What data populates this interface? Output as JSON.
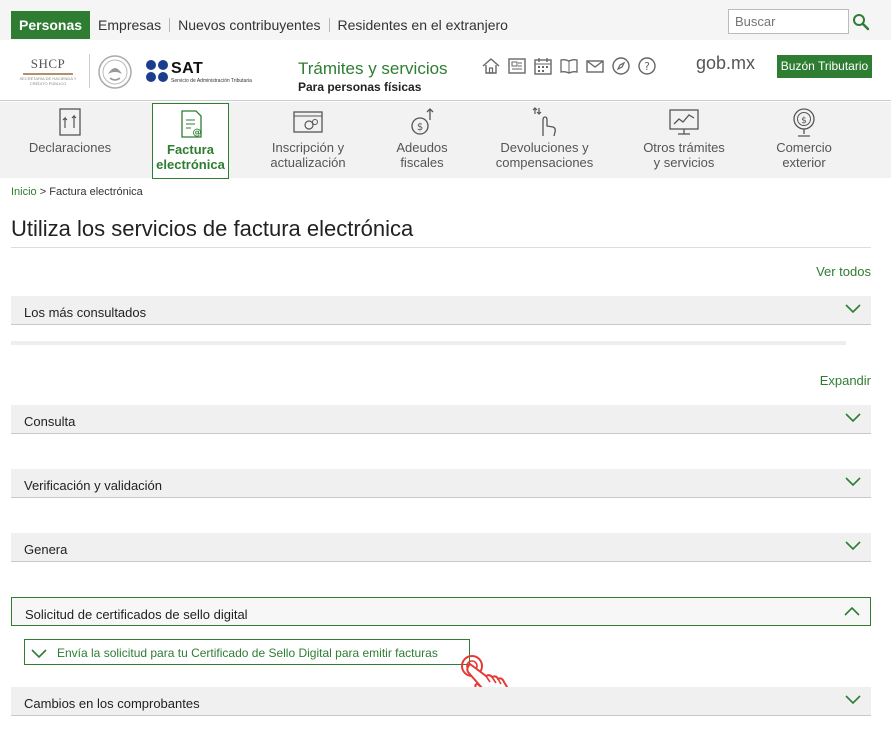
{
  "topbar": {
    "tabs": [
      {
        "label": "Personas",
        "active": true
      },
      {
        "label": "Empresas"
      },
      {
        "label": "Nuevos contribuyentes"
      },
      {
        "label": "Residentes en el extranjero"
      }
    ],
    "search_placeholder": "Buscar",
    "search_icon": "search-icon"
  },
  "header": {
    "shcp_logo": "SHCP",
    "shcp_sub": "SECRETARÍA DE HACIENDA Y CRÉDITO PÚBLICO",
    "sat_logo": "SAT",
    "sat_sub": "Servicio de Administración Tributaria",
    "title": "Trámites y servicios",
    "subtitle": "Para personas físicas",
    "icons": [
      "home-icon",
      "news-icon",
      "calendar-icon",
      "book-icon",
      "mail-icon",
      "compass-icon",
      "help-icon"
    ],
    "gobmx": "gob.mx",
    "buzon": "Buzón Tributario"
  },
  "categories": [
    {
      "line1": "Declaraciones",
      "line2": "",
      "icon": "declarations-icon"
    },
    {
      "line1": "Factura",
      "line2": "electrónica",
      "icon": "invoice-icon",
      "active": true
    },
    {
      "line1": "Inscripción y",
      "line2": "actualización",
      "icon": "registration-icon"
    },
    {
      "line1": "Adeudos",
      "line2": "fiscales",
      "icon": "debts-icon"
    },
    {
      "line1": "Devoluciones y",
      "line2": "compensaciones",
      "icon": "refunds-icon"
    },
    {
      "line1": "Otros trámites",
      "line2": "y servicios",
      "icon": "other-services-icon"
    },
    {
      "line1": "Comercio",
      "line2": "exterior",
      "icon": "foreign-trade-icon"
    }
  ],
  "breadcrumb": {
    "home": "Inicio",
    "separator": ">",
    "current": "Factura electrónica"
  },
  "page_title": "Utiliza los servicios de factura electrónica",
  "ver_todos": "Ver todos",
  "expandir": "Expandir",
  "accordions": {
    "mas_consultados": "Los más consultados",
    "consulta": "Consulta",
    "verificacion": "Verificación y validación",
    "genera": "Genera",
    "solicitud": "Solicitud de certificados de sello digital",
    "cambios": "Cambios en los comprobantes"
  },
  "subitem": "Envía la solicitud para tu Certificado de Sello Digital para emitir facturas",
  "colors": {
    "brand": "#2e7d32",
    "cursor": "#e53935"
  }
}
